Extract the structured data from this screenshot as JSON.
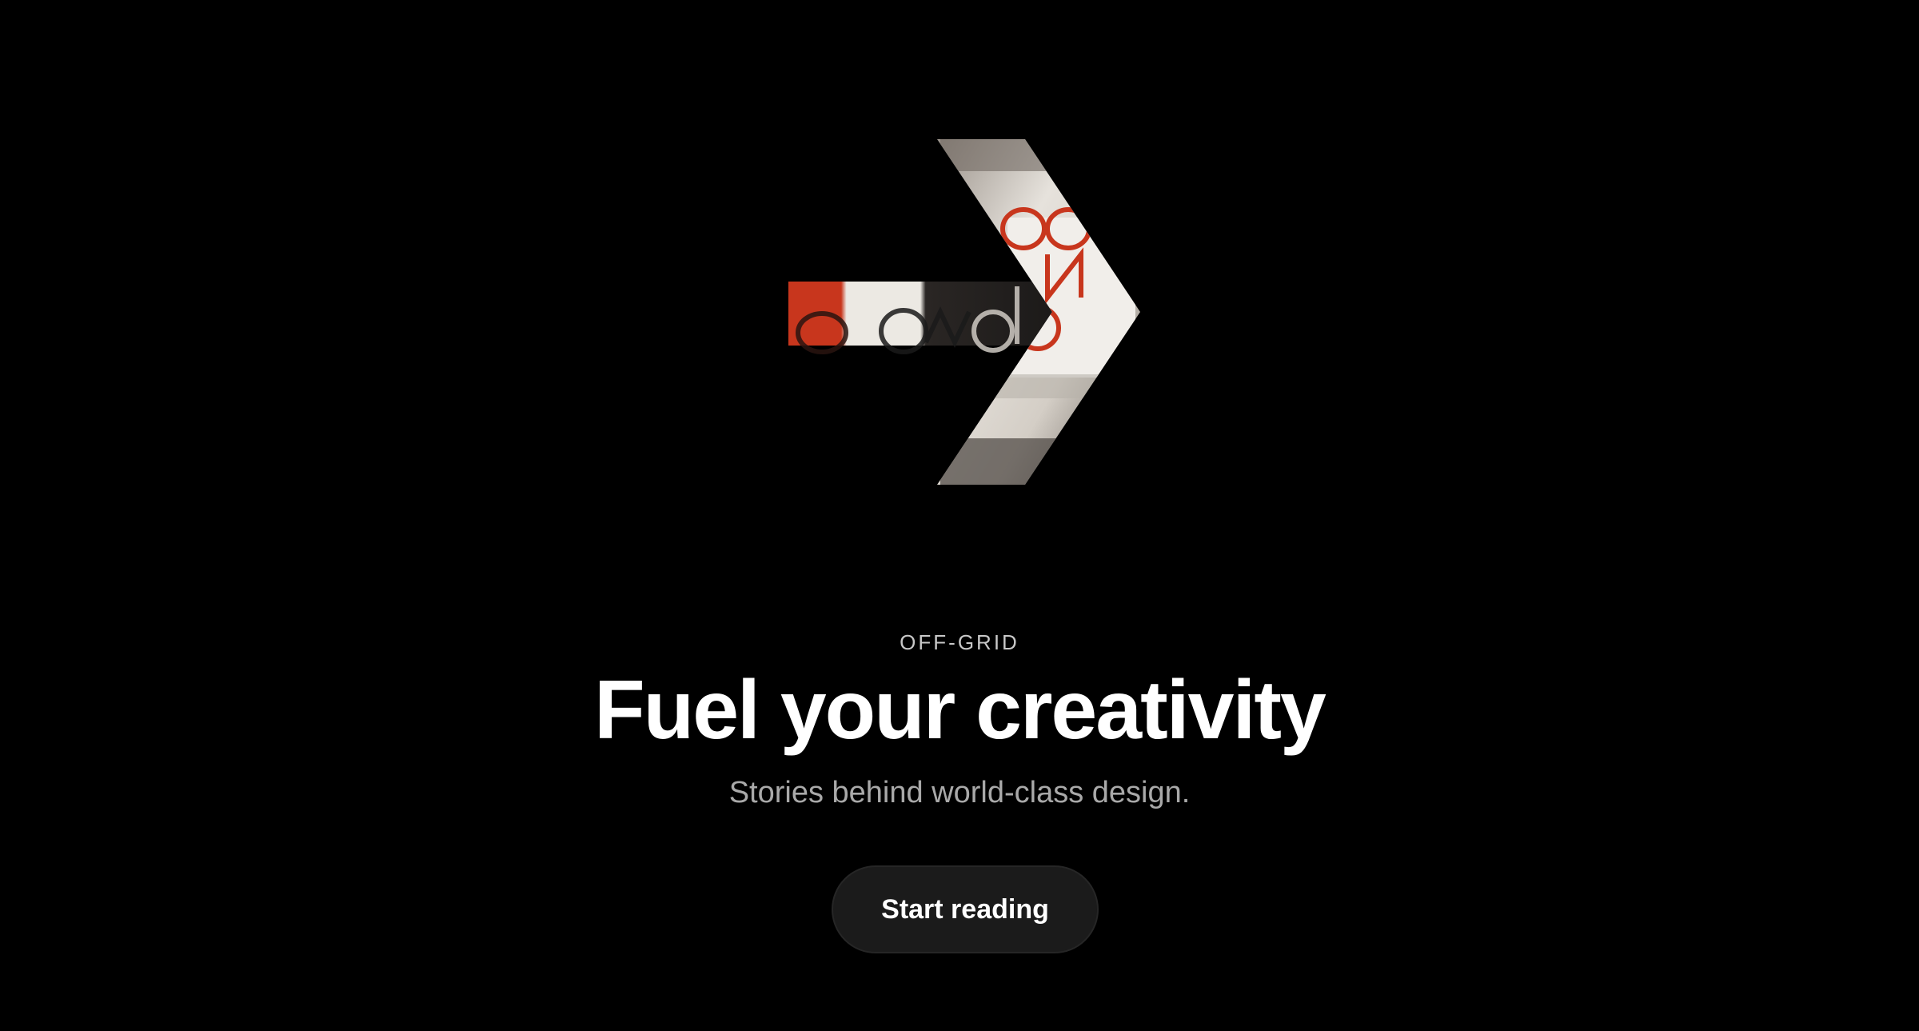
{
  "hero": {
    "eyebrow": "OFF-GRID",
    "headline": "Fuel your creativity",
    "subtitle": "Stories behind world-class design.",
    "cta_label": "Start reading"
  },
  "art": {
    "icon": "right-arrow-icon",
    "colors": {
      "background": "#000000",
      "accent_red": "#c8361d",
      "paper": "#e9e6e0",
      "stone": "#8d857b"
    }
  }
}
